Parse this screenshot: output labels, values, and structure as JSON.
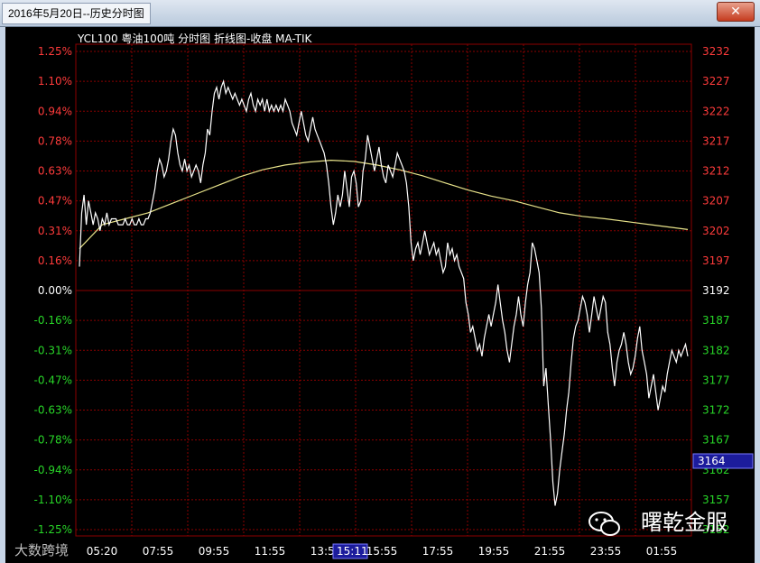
{
  "window": {
    "title": "2016年5月20日--历史分时图",
    "close_glyph": "✕"
  },
  "chart_header": "YCL100 粤油100吨 分时图  折线图-收盘 MA-TIK",
  "cursor_time": "15:11",
  "current_price_label": "3164",
  "watermark_text": "曙乾金服",
  "watermark_icon": "wechat-icon",
  "watermark_left": "大数跨境",
  "colors": {
    "up": "#ff3b3b",
    "down": "#28d628",
    "neutral": "#ffffff",
    "grid": "#8b0000",
    "price_line": "#ffffff",
    "avg_line": "#e8e38a",
    "price_box": "#1c1c9c"
  },
  "chart_data": {
    "type": "line",
    "base_price": 3192,
    "ylim": [
      3152,
      3232
    ],
    "y_ticks_price": [
      3232,
      3227,
      3222,
      3217,
      3212,
      3207,
      3202,
      3197,
      3192,
      3187,
      3182,
      3177,
      3172,
      3167,
      3162,
      3157,
      3152
    ],
    "y_ticks_pct": [
      "1.25%",
      "1.10%",
      "0.94%",
      "0.78%",
      "0.63%",
      "0.47%",
      "0.31%",
      "0.16%",
      "0.00%",
      "-0.16%",
      "-0.31%",
      "-0.47%",
      "-0.63%",
      "-0.78%",
      "-0.94%",
      "-1.10%",
      "-1.25%"
    ],
    "x_ticks": [
      "05:20",
      "07:55",
      "09:55",
      "11:55",
      "13:55",
      "15:55",
      "17:55",
      "19:55",
      "21:55",
      "23:55",
      "01:55"
    ],
    "price_series": [
      [
        0,
        3196
      ],
      [
        2,
        3205
      ],
      [
        4,
        3208
      ],
      [
        6,
        3203
      ],
      [
        8,
        3207
      ],
      [
        10,
        3205
      ],
      [
        12,
        3203
      ],
      [
        14,
        3205
      ],
      [
        16,
        3204
      ],
      [
        18,
        3202
      ],
      [
        20,
        3204
      ],
      [
        22,
        3203
      ],
      [
        24,
        3205
      ],
      [
        26,
        3203
      ],
      [
        28,
        3204
      ],
      [
        30,
        3204
      ],
      [
        32,
        3204
      ],
      [
        34,
        3203
      ],
      [
        36,
        3203
      ],
      [
        38,
        3203
      ],
      [
        40,
        3204
      ],
      [
        42,
        3203
      ],
      [
        44,
        3203
      ],
      [
        46,
        3204
      ],
      [
        48,
        3203
      ],
      [
        50,
        3203
      ],
      [
        52,
        3204
      ],
      [
        54,
        3203
      ],
      [
        56,
        3203
      ],
      [
        58,
        3204
      ],
      [
        60,
        3204
      ],
      [
        62,
        3205
      ],
      [
        64,
        3207
      ],
      [
        66,
        3209
      ],
      [
        68,
        3212
      ],
      [
        70,
        3214
      ],
      [
        72,
        3213
      ],
      [
        74,
        3211
      ],
      [
        76,
        3212
      ],
      [
        78,
        3214
      ],
      [
        80,
        3217
      ],
      [
        82,
        3219
      ],
      [
        84,
        3218
      ],
      [
        86,
        3215
      ],
      [
        88,
        3213
      ],
      [
        90,
        3212
      ],
      [
        92,
        3214
      ],
      [
        94,
        3212
      ],
      [
        96,
        3213
      ],
      [
        98,
        3211
      ],
      [
        100,
        3212
      ],
      [
        102,
        3213
      ],
      [
        104,
        3212
      ],
      [
        106,
        3210
      ],
      [
        108,
        3213
      ],
      [
        110,
        3215
      ],
      [
        112,
        3219
      ],
      [
        114,
        3218
      ],
      [
        116,
        3222
      ],
      [
        118,
        3225
      ],
      [
        120,
        3226
      ],
      [
        122,
        3224
      ],
      [
        124,
        3226
      ],
      [
        126,
        3227
      ],
      [
        128,
        3225
      ],
      [
        130,
        3226
      ],
      [
        132,
        3225
      ],
      [
        134,
        3224
      ],
      [
        136,
        3225
      ],
      [
        138,
        3224
      ],
      [
        140,
        3223
      ],
      [
        142,
        3224
      ],
      [
        144,
        3223
      ],
      [
        146,
        3222
      ],
      [
        148,
        3224
      ],
      [
        150,
        3225
      ],
      [
        152,
        3223
      ],
      [
        154,
        3222
      ],
      [
        156,
        3224
      ],
      [
        158,
        3223
      ],
      [
        160,
        3224
      ],
      [
        162,
        3222
      ],
      [
        164,
        3224
      ],
      [
        166,
        3222
      ],
      [
        168,
        3223
      ],
      [
        170,
        3222
      ],
      [
        172,
        3223
      ],
      [
        174,
        3222
      ],
      [
        176,
        3223
      ],
      [
        178,
        3222
      ],
      [
        180,
        3224
      ],
      [
        182,
        3223
      ],
      [
        184,
        3222
      ],
      [
        186,
        3220
      ],
      [
        188,
        3219
      ],
      [
        190,
        3218
      ],
      [
        192,
        3220
      ],
      [
        194,
        3222
      ],
      [
        196,
        3220
      ],
      [
        198,
        3218
      ],
      [
        200,
        3217
      ],
      [
        202,
        3219
      ],
      [
        204,
        3221
      ],
      [
        206,
        3219
      ],
      [
        208,
        3218
      ],
      [
        210,
        3217
      ],
      [
        212,
        3216
      ],
      [
        214,
        3215
      ],
      [
        216,
        3213
      ],
      [
        218,
        3210
      ],
      [
        220,
        3206
      ],
      [
        222,
        3203
      ],
      [
        224,
        3205
      ],
      [
        226,
        3208
      ],
      [
        228,
        3206
      ],
      [
        230,
        3208
      ],
      [
        232,
        3212
      ],
      [
        234,
        3209
      ],
      [
        236,
        3206
      ],
      [
        238,
        3211
      ],
      [
        240,
        3212
      ],
      [
        242,
        3210
      ],
      [
        244,
        3206
      ],
      [
        246,
        3207
      ],
      [
        248,
        3212
      ],
      [
        250,
        3214
      ],
      [
        252,
        3218
      ],
      [
        254,
        3216
      ],
      [
        256,
        3214
      ],
      [
        258,
        3212
      ],
      [
        260,
        3214
      ],
      [
        262,
        3216
      ],
      [
        264,
        3213
      ],
      [
        266,
        3211
      ],
      [
        268,
        3210
      ],
      [
        270,
        3213
      ],
      [
        272,
        3212
      ],
      [
        274,
        3211
      ],
      [
        276,
        3213
      ],
      [
        278,
        3215
      ],
      [
        280,
        3214
      ],
      [
        282,
        3213
      ],
      [
        284,
        3212
      ],
      [
        286,
        3210
      ],
      [
        288,
        3206
      ],
      [
        290,
        3200
      ],
      [
        292,
        3197
      ],
      [
        294,
        3199
      ],
      [
        296,
        3200
      ],
      [
        298,
        3198
      ],
      [
        300,
        3200
      ],
      [
        302,
        3202
      ],
      [
        304,
        3200
      ],
      [
        306,
        3198
      ],
      [
        308,
        3199
      ],
      [
        310,
        3200
      ],
      [
        312,
        3198
      ],
      [
        314,
        3199
      ],
      [
        316,
        3197
      ],
      [
        318,
        3195
      ],
      [
        320,
        3196
      ],
      [
        322,
        3200
      ],
      [
        324,
        3198
      ],
      [
        326,
        3199
      ],
      [
        328,
        3197
      ],
      [
        330,
        3198
      ],
      [
        332,
        3196
      ],
      [
        334,
        3195
      ],
      [
        336,
        3194
      ],
      [
        338,
        3190
      ],
      [
        340,
        3188
      ],
      [
        342,
        3185
      ],
      [
        344,
        3186
      ],
      [
        346,
        3184
      ],
      [
        348,
        3182
      ],
      [
        350,
        3183
      ],
      [
        352,
        3181
      ],
      [
        354,
        3184
      ],
      [
        356,
        3186
      ],
      [
        358,
        3188
      ],
      [
        360,
        3186
      ],
      [
        362,
        3188
      ],
      [
        364,
        3190
      ],
      [
        366,
        3193
      ],
      [
        368,
        3190
      ],
      [
        370,
        3187
      ],
      [
        372,
        3185
      ],
      [
        374,
        3182
      ],
      [
        376,
        3180
      ],
      [
        378,
        3183
      ],
      [
        380,
        3186
      ],
      [
        382,
        3188
      ],
      [
        384,
        3191
      ],
      [
        386,
        3188
      ],
      [
        388,
        3186
      ],
      [
        390,
        3190
      ],
      [
        392,
        3193
      ],
      [
        394,
        3195
      ],
      [
        396,
        3200
      ],
      [
        398,
        3199
      ],
      [
        400,
        3197
      ],
      [
        402,
        3195
      ],
      [
        404,
        3189
      ],
      [
        406,
        3176
      ],
      [
        408,
        3179
      ],
      [
        410,
        3173
      ],
      [
        412,
        3167
      ],
      [
        414,
        3160
      ],
      [
        416,
        3156
      ],
      [
        418,
        3158
      ],
      [
        420,
        3162
      ],
      [
        422,
        3165
      ],
      [
        424,
        3168
      ],
      [
        426,
        3172
      ],
      [
        428,
        3175
      ],
      [
        430,
        3180
      ],
      [
        432,
        3184
      ],
      [
        434,
        3186
      ],
      [
        436,
        3187
      ],
      [
        438,
        3189
      ],
      [
        440,
        3191
      ],
      [
        442,
        3190
      ],
      [
        444,
        3188
      ],
      [
        446,
        3185
      ],
      [
        448,
        3188
      ],
      [
        450,
        3191
      ],
      [
        452,
        3189
      ],
      [
        454,
        3187
      ],
      [
        456,
        3189
      ],
      [
        458,
        3191
      ],
      [
        460,
        3190
      ],
      [
        462,
        3185
      ],
      [
        464,
        3183
      ],
      [
        466,
        3179
      ],
      [
        468,
        3176
      ],
      [
        470,
        3180
      ],
      [
        472,
        3182
      ],
      [
        474,
        3183
      ],
      [
        476,
        3185
      ],
      [
        478,
        3183
      ],
      [
        480,
        3180
      ],
      [
        482,
        3178
      ],
      [
        484,
        3179
      ],
      [
        486,
        3181
      ],
      [
        488,
        3184
      ],
      [
        490,
        3186
      ],
      [
        492,
        3182
      ],
      [
        494,
        3180
      ],
      [
        496,
        3178
      ],
      [
        498,
        3174
      ],
      [
        500,
        3176
      ],
      [
        502,
        3178
      ],
      [
        504,
        3175
      ],
      [
        506,
        3172
      ],
      [
        508,
        3174
      ],
      [
        510,
        3176
      ],
      [
        512,
        3175
      ],
      [
        514,
        3178
      ],
      [
        516,
        3180
      ],
      [
        518,
        3182
      ],
      [
        520,
        3181
      ],
      [
        522,
        3180
      ],
      [
        524,
        3182
      ],
      [
        526,
        3181
      ],
      [
        528,
        3182
      ],
      [
        530,
        3183
      ],
      [
        532,
        3181
      ]
    ],
    "avg_series": [
      [
        0,
        3199
      ],
      [
        20,
        3203
      ],
      [
        40,
        3204
      ],
      [
        60,
        3205
      ],
      [
        80,
        3206.5
      ],
      [
        100,
        3208
      ],
      [
        120,
        3209.5
      ],
      [
        140,
        3211
      ],
      [
        160,
        3212.2
      ],
      [
        180,
        3213
      ],
      [
        200,
        3213.5
      ],
      [
        220,
        3213.8
      ],
      [
        240,
        3213.6
      ],
      [
        260,
        3213
      ],
      [
        280,
        3212.2
      ],
      [
        300,
        3211.2
      ],
      [
        320,
        3210
      ],
      [
        340,
        3208.8
      ],
      [
        360,
        3207.8
      ],
      [
        380,
        3207
      ],
      [
        400,
        3206
      ],
      [
        420,
        3205
      ],
      [
        440,
        3204.4
      ],
      [
        460,
        3204
      ],
      [
        480,
        3203.5
      ],
      [
        500,
        3203
      ],
      [
        520,
        3202.5
      ],
      [
        532,
        3202.2
      ]
    ]
  }
}
